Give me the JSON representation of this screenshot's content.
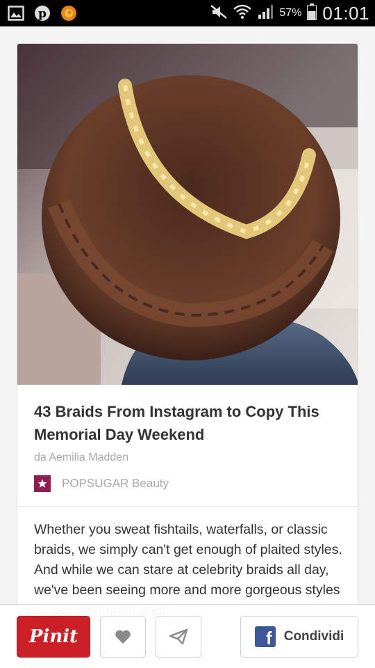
{
  "status_bar": {
    "battery": "57%",
    "time": "01:01"
  },
  "pin": {
    "title": "43 Braids From Instagram to Copy This Memorial Day Weekend",
    "author": "da Aemilia Madden",
    "source": "POPSUGAR Beauty",
    "description": "Whether you sweat fishtails, waterfalls, or classic braids, we simply can't get enough of plaited styles. And while we can stare at celebrity braids all day, we've been seeing more and more gorgeous styles on our Instagram feeds."
  },
  "actions": {
    "pin_it": "Pinit",
    "share": "Condividi"
  },
  "colors": {
    "pin_red": "#cb2027",
    "facebook_blue": "#3b5998",
    "source_icon": "#8e1e4f"
  },
  "icons": [
    "gallery-icon",
    "pinterest-icon",
    "firefox-icon",
    "mute-icon",
    "wifi-icon",
    "signal-icon",
    "battery-icon",
    "heart-icon",
    "send-icon",
    "facebook-icon",
    "star-icon"
  ]
}
